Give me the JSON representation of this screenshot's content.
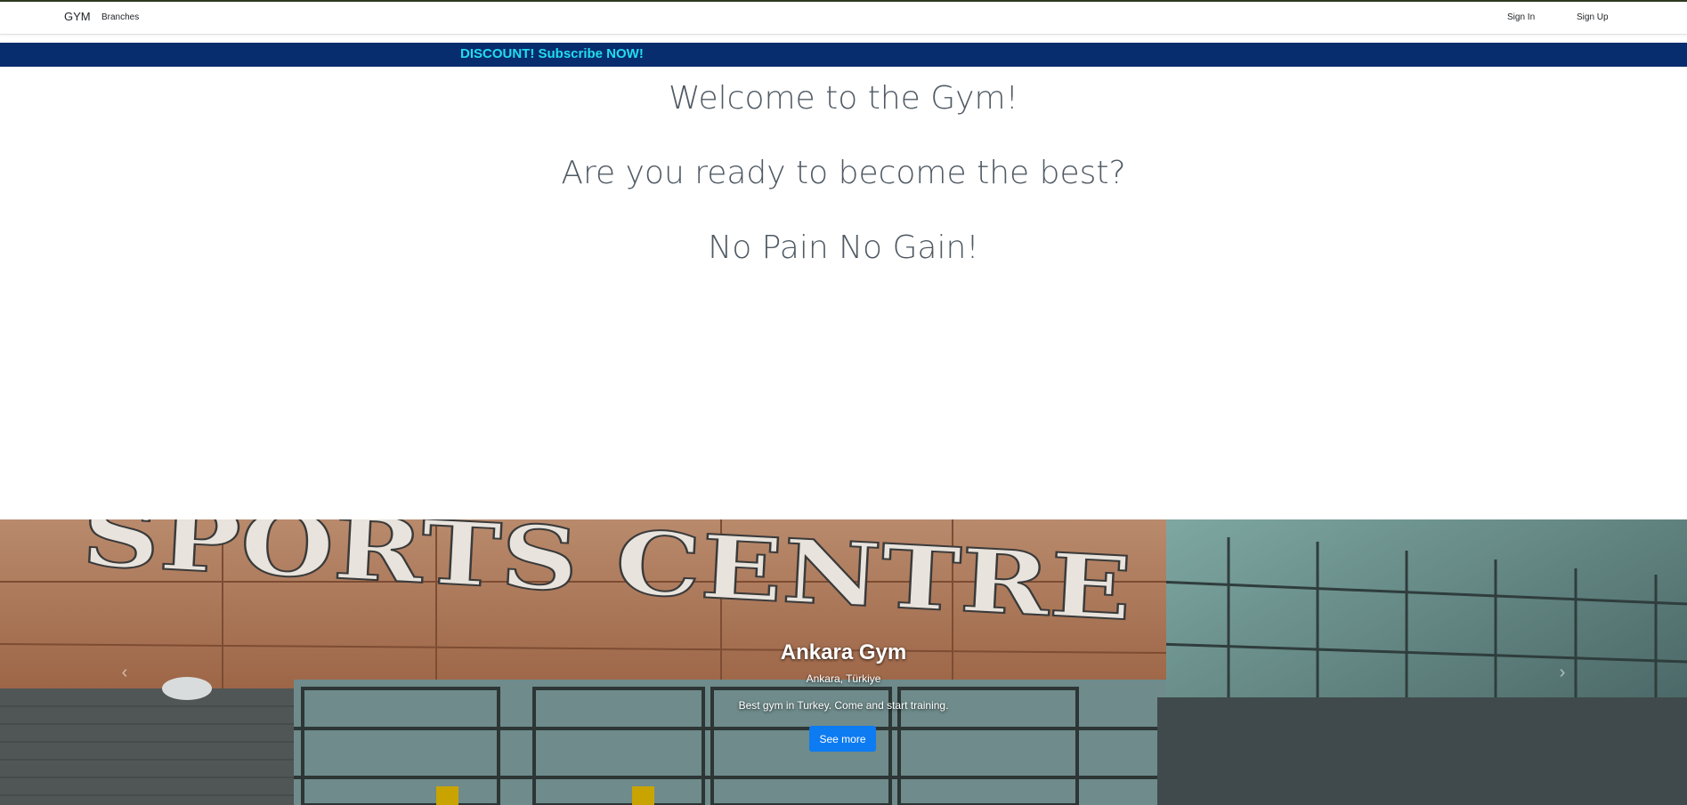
{
  "navbar": {
    "brand": "GYM",
    "links": {
      "branches": "Branches",
      "sign_in": "Sign In",
      "sign_up": "Sign Up"
    }
  },
  "banner": {
    "text": "DISCOUNT! Subscribe NOW!"
  },
  "headings": {
    "welcome": "Welcome to the Gym!",
    "ready": "Are you ready to become the best?",
    "motto": "No Pain No Gain!"
  },
  "carousel": {
    "image_label": "SPORTS CENTRE",
    "slide": {
      "title": "Ankara Gym",
      "location": "Ankara, Türkiye",
      "description": "Best gym in Turkey. Come and start training.",
      "button": "See more"
    },
    "prev_icon": "chevron-left-icon",
    "next_icon": "chevron-right-icon"
  },
  "colors": {
    "banner_bg": "#082d6e",
    "banner_text": "#22dcf0",
    "button_primary": "#0d7bf2"
  }
}
